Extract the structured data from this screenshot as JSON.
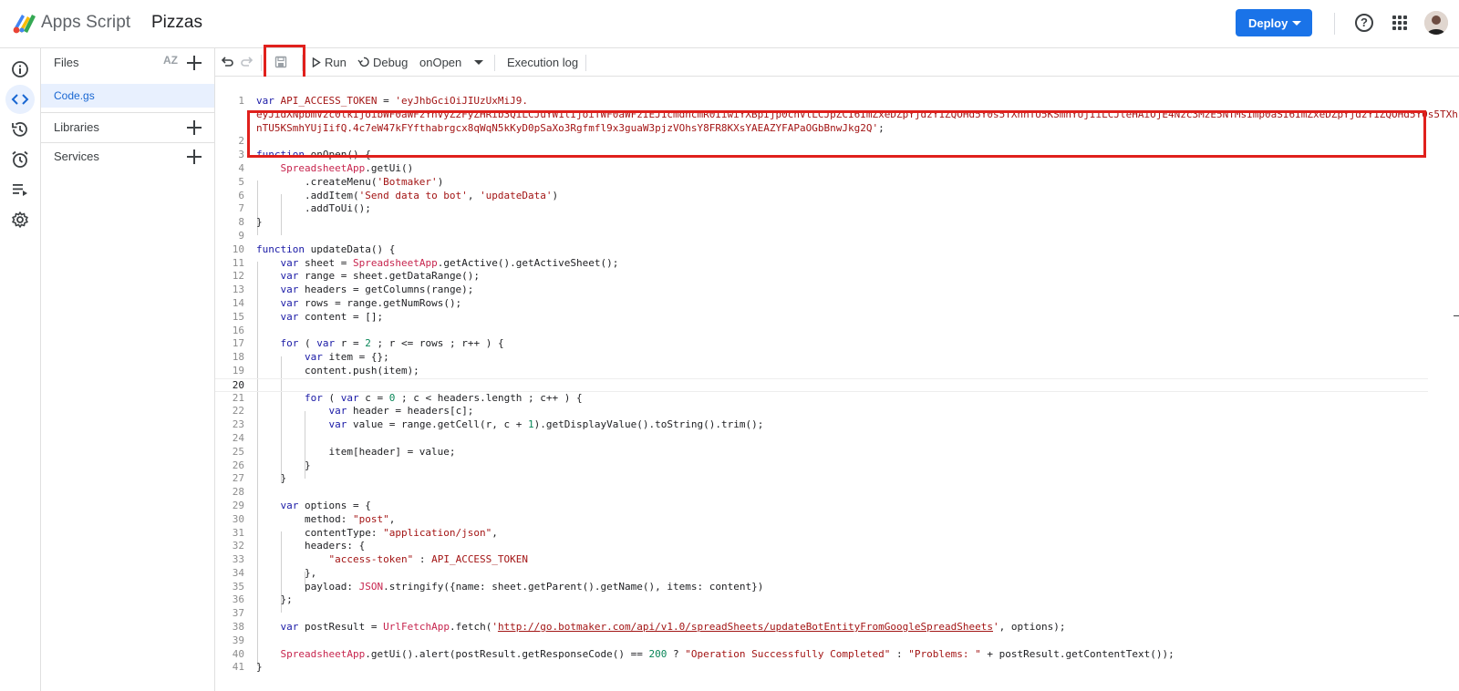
{
  "header": {
    "app_name": "Apps Script",
    "project_name": "Pizzas",
    "deploy_label": "Deploy",
    "help_icon": "?"
  },
  "rail": {
    "items": [
      {
        "name": "overview-icon",
        "active": false
      },
      {
        "name": "editor-icon",
        "active": true
      },
      {
        "name": "history-icon",
        "active": false
      },
      {
        "name": "triggers-icon",
        "active": false
      },
      {
        "name": "executions-icon",
        "active": false
      },
      {
        "name": "settings-icon",
        "active": false
      }
    ]
  },
  "files_panel": {
    "files_label": "Files",
    "sort_label": "AZ",
    "files": [
      "Code.gs"
    ],
    "libraries_label": "Libraries",
    "services_label": "Services"
  },
  "toolbar": {
    "run_label": "Run",
    "debug_label": "Debug",
    "function_select": "onOpen",
    "execution_log_label": "Execution log"
  },
  "colors": {
    "accent": "#1a73e8",
    "highlight_box": "#e0201c",
    "keyword": "#1a1aa6",
    "string": "#a31515"
  },
  "code_lines": [
    "var API_ACCESS_TOKEN = 'eyJhbGciOiJIUzUxMiJ9.",
    "eyJidXNpbmVzc0lkIjoibWF0aWFzYnVyZ2FyZHRib3QiLCJuYW1lIjoiTWF0aWFzIEJ1cmdhcmR0IiwiYXBpIjp0cnVlLCJpZCI6ImZxeDZpYjdzY1ZQOHd5Y0s5TXhnTU5KSmhYUjIiLCJleHAiOjE4Nzc3MzE5NTMsImp0aSI6ImZxeDZpYjdzY1ZQOHd5Y0s5TXh",
    "nTU5KSmhYUjIifQ.4c7eW47kFYfthabrgcx8qWqN5kKyD0pSaXo3Rgfmfl9x3guaW3pjzVOhsY8FR8KXsYAEAZYFAPaOGbBnwJkg2Q';",
    "",
    "function onOpen() {",
    "SpreadsheetApp.getUi()",
    ".createMenu('Botmaker')",
    ".addItem('Send data to bot', 'updateData')",
    ".addToUi();",
    "}",
    "",
    "function updateData() {",
    "var sheet = SpreadsheetApp.getActive().getActiveSheet();",
    "var range = sheet.getDataRange();",
    "var headers = getColumns(range);",
    "var rows = range.getNumRows();",
    "var content = [];",
    "",
    "for ( var r = 2 ; r <= rows ; r++ ) {",
    "var item = {};",
    "content.push(item);",
    "",
    "for ( var c = 0 ; c < headers.length ; c++ ) {",
    "var header = headers[c];",
    "var value = range.getCell(r, c + 1).getDisplayValue().toString().trim();",
    "",
    "item[header] = value;",
    "}",
    "}",
    "",
    "var options = {",
    "method: \"post\",",
    "contentType: \"application/json\",",
    "headers: {",
    "\"access-token\" : API_ACCESS_TOKEN",
    "},",
    "payload: JSON.stringify({name: sheet.getParent().getName(), items: content})",
    "};",
    "",
    "var postResult = UrlFetchApp.fetch('http://go.botmaker.com/api/v1.0/spreadSheets/updateBotEntityFromGoogleSpreadSheets', options);",
    "",
    "SpreadsheetApp.getUi().alert(postResult.getResponseCode() == 200 ? \"Operation Successfully Completed\" : \"Problems: \" + postResult.getContentText());",
    "}"
  ],
  "line_numbers": [
    "1",
    "",
    "",
    "2",
    "3",
    "4",
    "5",
    "6",
    "7",
    "8",
    "9",
    "10",
    "11",
    "12",
    "13",
    "14",
    "15",
    "16",
    "17",
    "18",
    "19",
    "20",
    "21",
    "22",
    "23",
    "24",
    "25",
    "26",
    "27",
    "28",
    "29",
    "30",
    "31",
    "32",
    "33",
    "34",
    "35",
    "36",
    "37",
    "38",
    "39",
    "40",
    "41"
  ],
  "current_line": "20"
}
